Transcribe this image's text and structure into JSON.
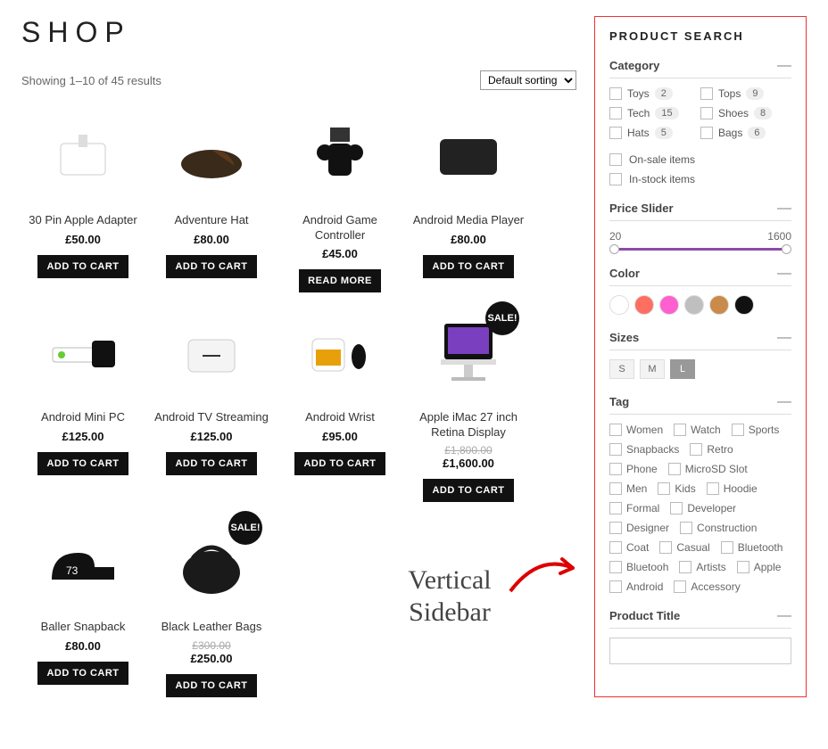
{
  "page": {
    "title": "SHOP",
    "result_text": "Showing 1–10 of 45 results",
    "sort_label": "Default sorting",
    "sale_badge": "SALE!"
  },
  "buttons": {
    "add": "ADD TO CART",
    "read": "READ MORE"
  },
  "products": [
    {
      "name": "30 Pin Apple Adapter",
      "price": "£50.00",
      "btn": "add"
    },
    {
      "name": "Adventure Hat",
      "price": "£80.00",
      "btn": "add"
    },
    {
      "name": "Android Game Controller",
      "price": "£45.00",
      "btn": "read"
    },
    {
      "name": "Android Media Player",
      "price": "£80.00",
      "btn": "add"
    },
    {
      "name": "Android Mini PC",
      "price": "£125.00",
      "btn": "add"
    },
    {
      "name": "Android TV Streaming",
      "price": "£125.00",
      "btn": "add"
    },
    {
      "name": "Android Wrist",
      "price": "£95.00",
      "btn": "add"
    },
    {
      "name": "Apple iMac 27 inch Retina Display",
      "old": "£1,800.00",
      "price": "£1,600.00",
      "btn": "add",
      "sale": true
    },
    {
      "name": "Baller Snapback",
      "price": "£80.00",
      "btn": "add"
    },
    {
      "name": "Black Leather Bags",
      "old": "£300.00",
      "price": "£250.00",
      "btn": "add",
      "sale": true
    }
  ],
  "sidebar": {
    "title": "PRODUCT SEARCH",
    "sections": {
      "category": "Category",
      "price": "Price Slider",
      "color": "Color",
      "sizes": "Sizes",
      "tag": "Tag",
      "ptitle": "Product Title"
    },
    "categories": [
      {
        "name": "Toys",
        "count": "2"
      },
      {
        "name": "Tops",
        "count": "9"
      },
      {
        "name": "Tech",
        "count": "15"
      },
      {
        "name": "Shoes",
        "count": "8"
      },
      {
        "name": "Hats",
        "count": "5"
      },
      {
        "name": "Bags",
        "count": "6"
      }
    ],
    "toggles": {
      "onsale": "On-sale items",
      "instock": "In-stock items"
    },
    "price": {
      "min": "20",
      "max": "1600"
    },
    "colors": [
      "#ffffff",
      "#ff6f61",
      "#ff5fcf",
      "#bfbfbf",
      "#c98a4a",
      "#111111"
    ],
    "sizes": [
      {
        "label": "S",
        "on": false
      },
      {
        "label": "M",
        "on": false
      },
      {
        "label": "L",
        "on": true
      }
    ],
    "tags": [
      "Women",
      "Watch",
      "Sports",
      "Snapbacks",
      "Retro",
      "Phone",
      "MicroSD Slot",
      "Men",
      "Kids",
      "Hoodie",
      "Formal",
      "Developer",
      "Designer",
      "Construction",
      "Coat",
      "Casual",
      "Bluetooth",
      "Bluetooh",
      "Artists",
      "Apple",
      "Android",
      "Accessory"
    ]
  },
  "annotation": {
    "line1": "Vertical",
    "line2": "Sidebar"
  }
}
